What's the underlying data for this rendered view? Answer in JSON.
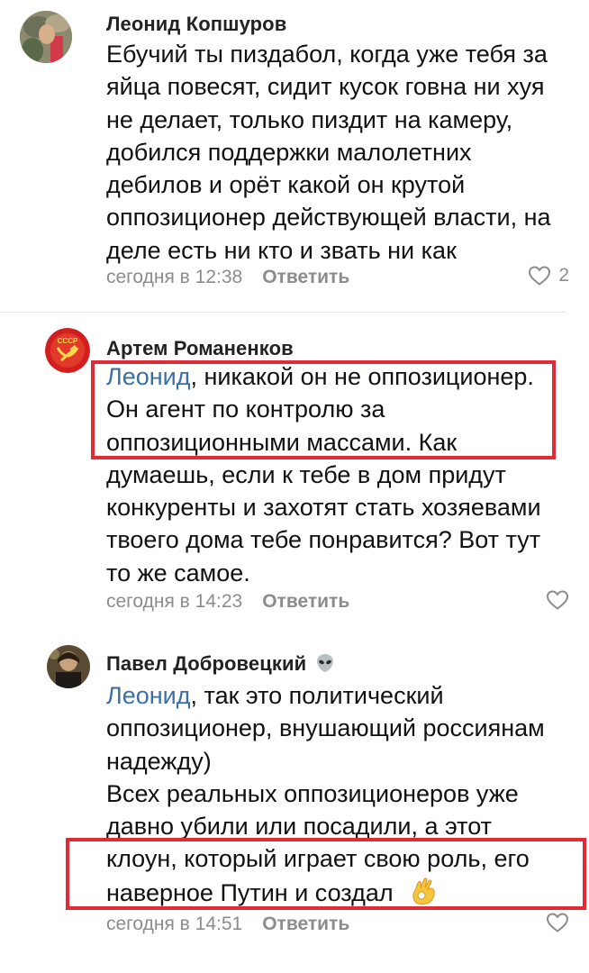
{
  "comments": [
    {
      "author": "Леонид Копшуров",
      "lines": [
        "Ебучий ты пиздабол, когда уже тебя за",
        "яйца повесят, сидит кусок говна ни хуя",
        "не делает, только пиздит на камеру,",
        "добился поддержки малолетних",
        "дебилов и орёт какой он крутой",
        "оппозиционер действующей власти, на",
        "деле есть ни кто и звать ни как"
      ],
      "time": "сегодня в 12:38",
      "reply": "Ответить",
      "likes": "2"
    },
    {
      "author": "Артем Романенков",
      "mention": "Леонид",
      "first_line_rest": ", никакой он не оппозиционер.",
      "lines": [
        "Он агент по контролю за",
        "оппозиционными массами. Как",
        "думаешь, если к тебе в дом придут",
        "конкуренты и захотят стать хозяевами",
        "твоего дома тебе понравится? Вот тут",
        "то же самое."
      ],
      "time": "сегодня в 14:23",
      "reply": "Ответить"
    },
    {
      "author": "Павел Добровецкий",
      "author_badge": "alien-emoji",
      "mention": "Леонид",
      "first_line_rest": ", так это политический",
      "lines": [
        "оппозиционер, внушающий россиянам",
        "надежду)",
        "Всех реальных оппозиционеров уже",
        "давно убили или посадили, а этот",
        "клоун, который играет свою роль, его",
        "наверное Путин и создал"
      ],
      "end_emoji": "ok-hand-emoji",
      "time": "сегодня в 14:51",
      "reply": "Ответить"
    }
  ],
  "colors": {
    "link": "#3b6fa5",
    "meta": "#8c8c8c",
    "highlight": "#e02a36"
  }
}
